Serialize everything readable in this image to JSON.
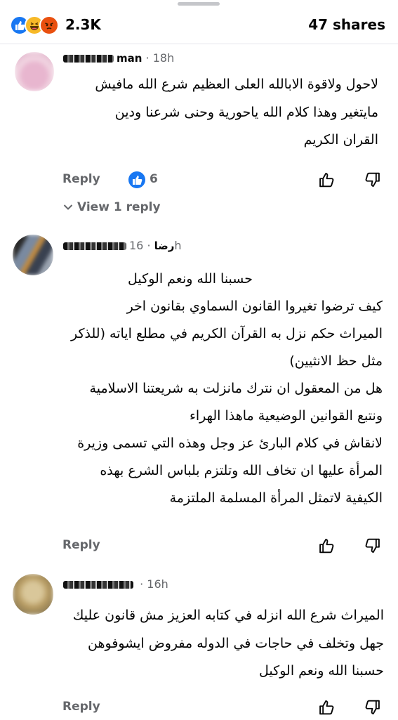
{
  "summary": {
    "reaction_count": "2.3K",
    "shares": "47 shares",
    "reactions": [
      "like-icon",
      "haha-icon",
      "angry-icon"
    ]
  },
  "comments": [
    {
      "author_visible": "man",
      "time": "· 18h",
      "lines": [
        "لاحول ولاقوة الابالله العلى العظيم شرع الله مافيش",
        "مايتغير وهذا كلام الله ياحورية وحنى شرعنا ودين",
        "القران الكريم"
      ],
      "reply_label": "Reply",
      "like_count": "6",
      "view_replies": "View 1 reply"
    },
    {
      "author_visible": "رضا",
      "time": "· 16h",
      "lines": [
        "حسبنا الله ونعم الوكيل",
        "كيف ترضوا تغيروا القانون السماوي بقانون اخر",
        "الميراث حكم نزل به القرآن الكريم في مطلع اياته (للذكر",
        "مثل حظ الانثيين)",
        "هل من المعقول ان نترك مانزلت به شريعتنا الاسلامية",
        "ونتبع القوانين الوضيعية ماهذا الهراء",
        "لانقاش في كلام البارئ عز وجل وهذه التي تسمى وزيرة",
        "المرأة عليها ان تخاف الله وتلتزم بلباس الشرع بهذه",
        "الكيفية لاتمثل المرأة المسلمة الملتزمة"
      ],
      "reply_label": "Reply"
    },
    {
      "author_visible": "",
      "time": "· 16h",
      "lines": [
        "الميراث شرع الله انزله في كتابه العزيز مش قانون عليك",
        "جهل وتخلف في حاجات في الدوله مفروض ايشوفوهن",
        "حسبنا الله ونعم الوكيل"
      ],
      "reply_label": "Reply"
    }
  ],
  "colors": {
    "facebook_blue": "#1877f2",
    "meta_gray": "#65676b",
    "divider": "#e4e6eb"
  }
}
